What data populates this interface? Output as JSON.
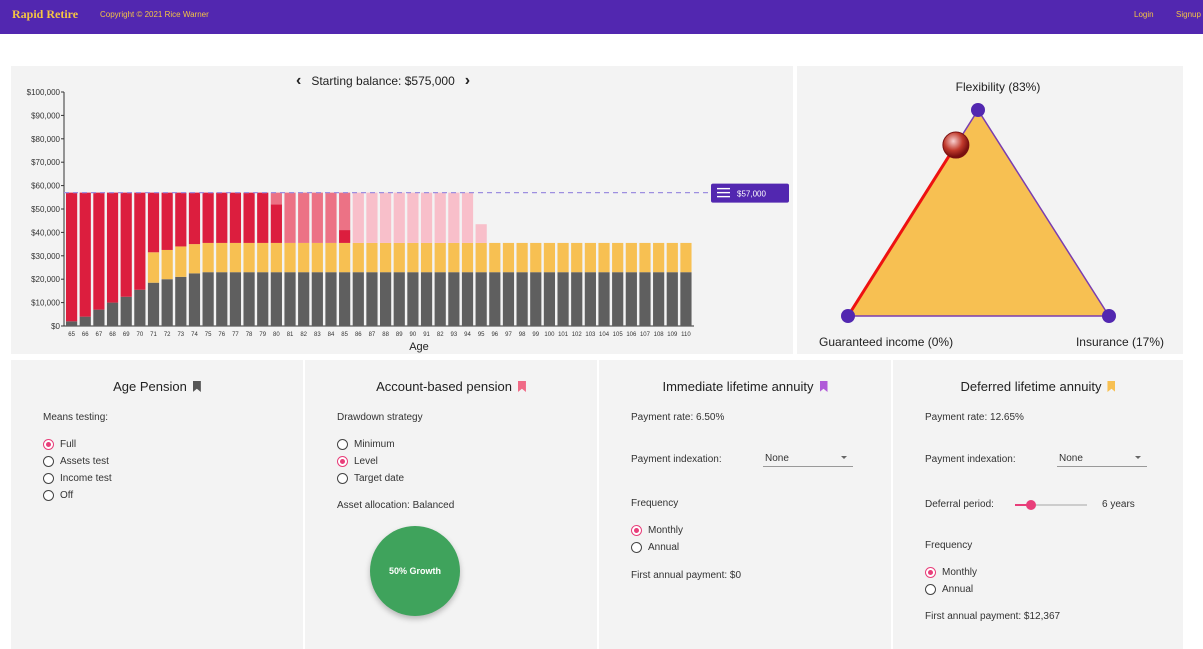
{
  "header": {
    "brand": "Rapid Retire",
    "copyright": "Copyright © 2021 Rice Warner",
    "login": "Login",
    "signup": "Signup"
  },
  "balance": {
    "label": "Starting balance: $575,000",
    "prev_icon": "chevron-left-icon",
    "next_icon": "chevron-right-icon"
  },
  "chart_data": {
    "type": "bar",
    "stacked": true,
    "xlabel": "Age",
    "ylabel": "",
    "ylim": [
      0,
      100000
    ],
    "yticks": [
      "$0",
      "$10,000",
      "$20,000",
      "$30,000",
      "$40,000",
      "$50,000",
      "$60,000",
      "$70,000",
      "$80,000",
      "$90,000",
      "$100,000"
    ],
    "categories": [
      65,
      66,
      67,
      68,
      69,
      70,
      71,
      72,
      73,
      74,
      75,
      76,
      77,
      78,
      79,
      80,
      81,
      82,
      83,
      84,
      85,
      86,
      87,
      88,
      89,
      90,
      91,
      82,
      93,
      94,
      95,
      96,
      97,
      98,
      99,
      100,
      101,
      102,
      103,
      104,
      105,
      106,
      107,
      108,
      109,
      110
    ],
    "series": [
      {
        "color": "#5f5f5f",
        "values": [
          2000,
          4000,
          7000,
          10000,
          12500,
          15500,
          18500,
          20000,
          21000,
          22500,
          23000,
          23000,
          23000,
          23000,
          23000,
          23000,
          23000,
          23000,
          23000,
          23000,
          23000,
          23000,
          23000,
          23000,
          23000,
          23000,
          23000,
          23000,
          23000,
          23000,
          23000,
          23000,
          23000,
          23000,
          23000,
          23000,
          23000,
          23000,
          23000,
          23000,
          23000,
          23000,
          23000,
          23000,
          23000,
          23000
        ]
      },
      {
        "color": "#f7c052",
        "values": [
          0,
          0,
          0,
          0,
          0,
          0,
          13000,
          12500,
          13000,
          12500,
          12500,
          12500,
          12500,
          12500,
          12500,
          12500,
          12500,
          12500,
          12500,
          12500,
          12500,
          12500,
          12500,
          12500,
          12500,
          12500,
          12500,
          12500,
          12500,
          12500,
          12500,
          12500,
          12500,
          12500,
          12500,
          12500,
          12500,
          12500,
          12500,
          12500,
          12500,
          12500,
          12500,
          12500,
          12500,
          12500
        ]
      },
      {
        "color": "#dc1e3e",
        "values": [
          55000,
          53000,
          50000,
          47000,
          44500,
          41500,
          25500,
          24500,
          23000,
          22000,
          21500,
          21500,
          21500,
          21500,
          21500,
          16500,
          0,
          0,
          0,
          0,
          5500,
          0,
          0,
          0,
          0,
          0,
          0,
          0,
          0,
          0,
          0,
          0,
          0,
          0,
          0,
          0,
          0,
          0,
          0,
          0,
          0,
          0,
          0,
          0,
          0,
          0
        ]
      },
      {
        "color": "#ec7285",
        "values": [
          0,
          0,
          0,
          0,
          0,
          0,
          0,
          0,
          0,
          0,
          0,
          0,
          0,
          0,
          0,
          5000,
          21500,
          21500,
          21500,
          21500,
          16000,
          0,
          0,
          0,
          0,
          0,
          0,
          0,
          0,
          0,
          0,
          0,
          0,
          0,
          0,
          0,
          0,
          0,
          0,
          0,
          0,
          0,
          0,
          0,
          0,
          0
        ]
      },
      {
        "color": "#f8bfca",
        "values": [
          0,
          0,
          0,
          0,
          0,
          0,
          0,
          0,
          0,
          0,
          0,
          0,
          0,
          0,
          0,
          0,
          0,
          0,
          0,
          0,
          0,
          21500,
          21500,
          21500,
          21500,
          21500,
          21500,
          21500,
          21500,
          21500,
          8000,
          0,
          0,
          0,
          0,
          0,
          0,
          0,
          0,
          0,
          0,
          0,
          0,
          0,
          0,
          0
        ]
      }
    ],
    "target": {
      "value": 57000,
      "label": "$57,000",
      "icon": "menu-icon"
    }
  },
  "triangle": {
    "flexibility": "Flexibility (83%)",
    "guaranteed": "Guaranteed income (0%)",
    "insurance": "Insurance (17%)",
    "weights": {
      "flexibility": 0.83,
      "guaranteed": 0.0,
      "insurance": 0.17
    }
  },
  "age_pension": {
    "title": "Age Pension",
    "bookmark_color": "#555555",
    "means_label": "Means testing:",
    "options": [
      "Full",
      "Assets test",
      "Income test",
      "Off"
    ],
    "selected": "Full"
  },
  "account_pension": {
    "title": "Account-based pension",
    "bookmark_color": "#f06a86",
    "drawdown_label": "Drawdown strategy",
    "options": [
      "Minimum",
      "Level",
      "Target date"
    ],
    "selected": "Level",
    "allocation_label": "Asset allocation: Balanced",
    "growth_label": "50% Growth"
  },
  "immediate_annuity": {
    "title": "Immediate lifetime annuity",
    "bookmark_color": "#b05ad8",
    "payment_rate": "Payment rate: 6.50%",
    "indexation_label": "Payment indexation:",
    "indexation_value": "None",
    "frequency_label": "Frequency",
    "freq_options": [
      "Monthly",
      "Annual"
    ],
    "freq_selected": "Monthly",
    "first_payment": "First annual payment: $0"
  },
  "deferred_annuity": {
    "title": "Deferred lifetime annuity",
    "bookmark_color": "#f7c052",
    "payment_rate": "Payment rate: 12.65%",
    "indexation_label": "Payment indexation:",
    "indexation_value": "None",
    "deferral_label": "Deferral period:",
    "deferral_value": "6 years",
    "deferral_fraction": 0.22,
    "frequency_label": "Frequency",
    "freq_options": [
      "Monthly",
      "Annual"
    ],
    "freq_selected": "Monthly",
    "first_payment": "First annual payment: $12,367"
  }
}
